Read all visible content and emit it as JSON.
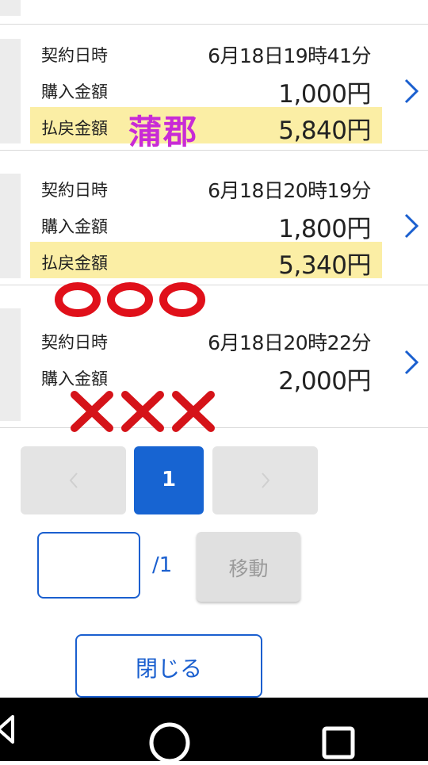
{
  "labels": {
    "contract_datetime": "契約日時",
    "purchase_amount": "購入金額",
    "payout_amount": "払戻金額"
  },
  "records": [
    {
      "datetime": "6月18日19時41分",
      "purchase": "1,000円",
      "payout": "5,840円"
    },
    {
      "datetime": "6月18日20時19分",
      "purchase": "1,800円",
      "payout": "5,340円"
    },
    {
      "datetime": "6月18日20時22分",
      "purchase": "2,000円"
    }
  ],
  "annotations": {
    "venue_text": "蒲郡",
    "venue_color": "#c82bd6",
    "circle_color": "#e0101a",
    "cross_color": "#d51319"
  },
  "pagination": {
    "current_page": "1",
    "page_input_value": "",
    "total_pages_text": "/1",
    "move_button": "移動"
  },
  "close_button": "閉じる",
  "colors": {
    "accent": "#1764d2",
    "highlight_row": "#fbeea5",
    "disabled_button": "#e4e4e4"
  },
  "navbar": {
    "icons": [
      "back-icon",
      "home-icon",
      "recents-icon"
    ]
  }
}
